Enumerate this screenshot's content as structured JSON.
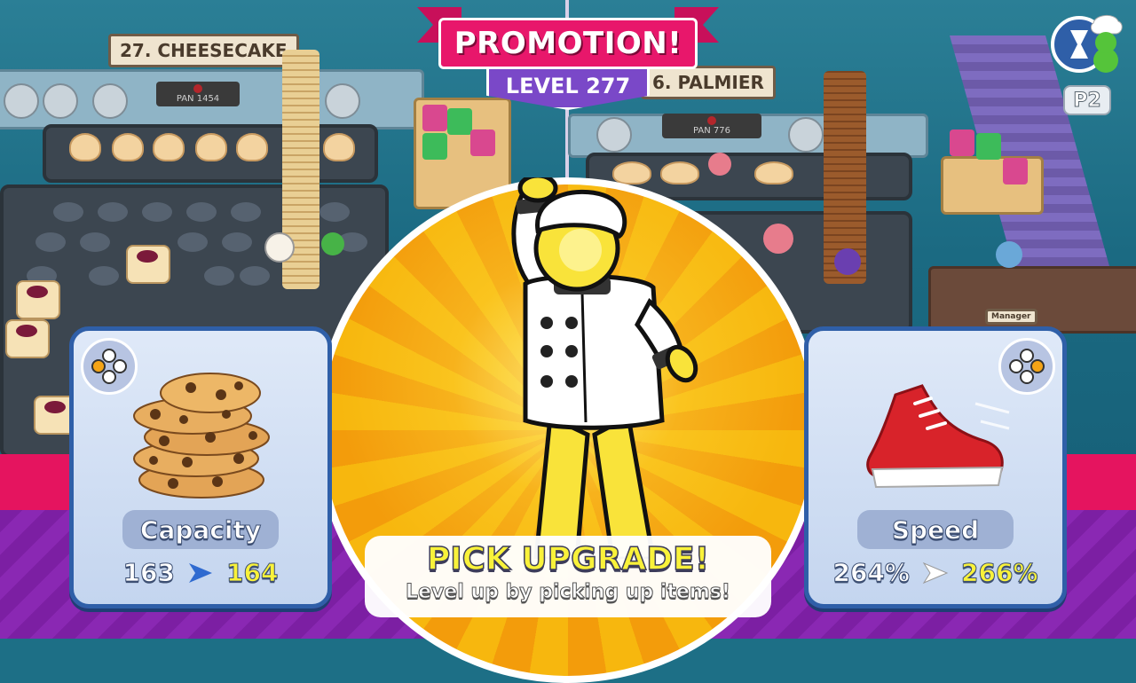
{
  "banner": {
    "title": "PROMOTION!",
    "level": "LEVEL 277"
  },
  "scene": {
    "station_left": "27. CHEESECAKE",
    "station_right": "6. PALMIER",
    "pan_left": "PAN 1454",
    "pan_right": "PAN 776",
    "manager_sign": "Manager"
  },
  "cards": {
    "left": {
      "icon": "cookie-stack-icon",
      "label": "Capacity",
      "old_value": "163",
      "new_value": "164"
    },
    "right": {
      "icon": "sneaker-icon",
      "label": "Speed",
      "old_value": "264%",
      "new_value": "266%"
    }
  },
  "prompt": {
    "title": "PICK UPGRADE!",
    "subtitle": "Level up by picking up items!"
  },
  "player": {
    "label": "P2",
    "icon": "hourglass-icon"
  },
  "colors": {
    "ribbon": "#e8176b",
    "level_badge": "#7a48c8",
    "card_border": "#2f5fa8",
    "highlight_value": "#f9f23a",
    "burst_orange": "#f39c0b"
  }
}
